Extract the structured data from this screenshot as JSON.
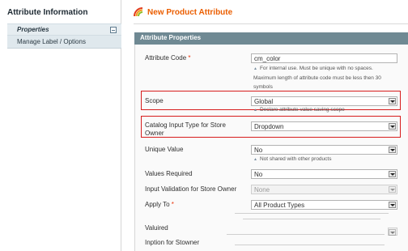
{
  "sidebar": {
    "title": "Attribute Information",
    "tabs": [
      {
        "label": "Properties"
      },
      {
        "label": "Manage Label / Options"
      }
    ]
  },
  "header": {
    "title": "New Product Attribute"
  },
  "section": {
    "title": "Attribute Properties"
  },
  "fields": {
    "attribute_code": {
      "label": "Attribute Code",
      "required": "*",
      "value": "cm_color",
      "hint_line1": "For internal use. Must be unique with no spaces.",
      "hint_line2": "Maximum length of attribute code must be less then 30",
      "hint_line3": "symbols"
    },
    "scope": {
      "label": "Scope",
      "value": "Global",
      "hint": "Declare attribute value saving scope"
    },
    "input_type": {
      "label_line1": "Catalog Input Type for Store",
      "label_line2": "Owner",
      "value": "Dropdown"
    },
    "unique_value": {
      "label": "Unique Value",
      "value": "No",
      "hint": "Not shared with other products"
    },
    "values_required": {
      "label": "Values Required",
      "value": "No"
    },
    "input_validation": {
      "label": "Input Validation for Store Owner",
      "value": "None"
    },
    "apply_to": {
      "label": "Apply To",
      "required": "*",
      "value": "All Product Types"
    },
    "partial1": {
      "label": "Valuired"
    },
    "partial2": {
      "label": "Inption for Stowner"
    }
  },
  "colors": {
    "accent": "#eb5e00",
    "section_bar": "#6f8993",
    "highlight_border": "#d71d1d",
    "required": "#eb340a"
  }
}
